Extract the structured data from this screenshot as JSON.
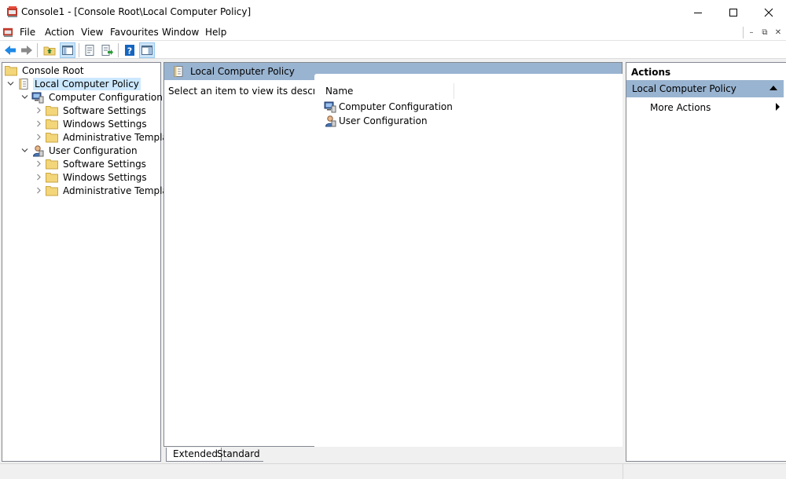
{
  "window": {
    "title": "Console1 - [Console Root\\Local Computer Policy]",
    "controls": {
      "minimize": "minimize",
      "maximize": "maximize",
      "close": "close"
    }
  },
  "menu": {
    "items": [
      "File",
      "Action",
      "View",
      "Favourites",
      "Window",
      "Help"
    ],
    "mdi_controls": [
      "–",
      "⧉",
      "✕"
    ]
  },
  "toolbar": {
    "buttons": [
      "back",
      "forward",
      "up-one-level",
      "show-hide-console-tree",
      "properties",
      "export-list",
      "help",
      "show-hide-action-pane"
    ]
  },
  "tree": {
    "items": [
      {
        "label": "Console Root",
        "icon": "folder-icon",
        "expander": ""
      },
      {
        "label": "Local Computer Policy",
        "icon": "policy-icon",
        "expander": "expanded",
        "selected": true
      },
      {
        "label": "Computer Configuration",
        "icon": "computer-icon",
        "expander": "expanded"
      },
      {
        "label": "Software Settings",
        "icon": "folder-icon",
        "expander": "collapsed"
      },
      {
        "label": "Windows Settings",
        "icon": "folder-icon",
        "expander": "collapsed"
      },
      {
        "label": "Administrative Templates",
        "icon": "folder-icon",
        "expander": "collapsed"
      },
      {
        "label": "User Configuration",
        "icon": "user-icon",
        "expander": "expanded"
      },
      {
        "label": "Software Settings",
        "icon": "folder-icon",
        "expander": "collapsed"
      },
      {
        "label": "Windows Settings",
        "icon": "folder-icon",
        "expander": "collapsed"
      },
      {
        "label": "Administrative Templates",
        "icon": "folder-icon",
        "expander": "collapsed"
      }
    ]
  },
  "content": {
    "header_title": "Local Computer Policy",
    "description": "Select an item to view its description.",
    "column_name": "Name",
    "rows": [
      {
        "label": "Computer Configuration",
        "icon": "computer-icon"
      },
      {
        "label": "User Configuration",
        "icon": "user-icon"
      }
    ],
    "tabs": [
      "Extended",
      "Standard"
    ],
    "active_tab": "Extended"
  },
  "actions": {
    "title": "Actions",
    "group_label": "Local Computer Policy",
    "items": [
      {
        "label": "More Actions"
      }
    ]
  },
  "colors": {
    "header_blue": "#99b4d1",
    "selection": "#cce8ff",
    "folder_yellow": "#f3d57a"
  }
}
